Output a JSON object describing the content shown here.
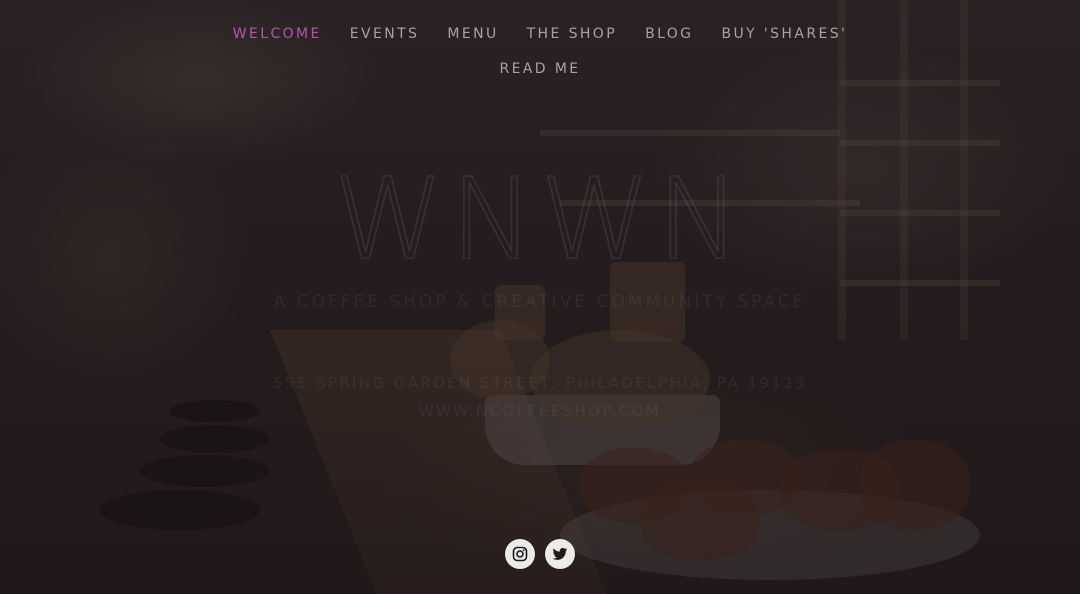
{
  "nav": {
    "row1": [
      {
        "label": "WELCOME",
        "active": true
      },
      {
        "label": "EVENTS",
        "active": false
      },
      {
        "label": "MENU",
        "active": false
      },
      {
        "label": "THE SHOP",
        "active": false
      },
      {
        "label": "BLOG",
        "active": false
      },
      {
        "label": "BUY 'SHARES'",
        "active": false
      }
    ],
    "row2": [
      {
        "label": "READ ME",
        "active": false
      }
    ]
  },
  "hero": {
    "logo_text": "WNWN",
    "tagline": "A COFFEE SHOP & CREATIVE COMMUNITY SPACE",
    "address": "555 SPRING GARDEN STREET, PHILADELPHIA, PA 19123",
    "website": "WWW.NCOFFEESHOP.COM"
  },
  "social": [
    {
      "icon": "instagram-icon"
    },
    {
      "icon": "twitter-icon"
    }
  ],
  "colors": {
    "nav_text": "#a6a2a6",
    "nav_active": "#b453b0",
    "icon_bg": "#ecebea",
    "icon_fg": "#1f1a1c"
  }
}
